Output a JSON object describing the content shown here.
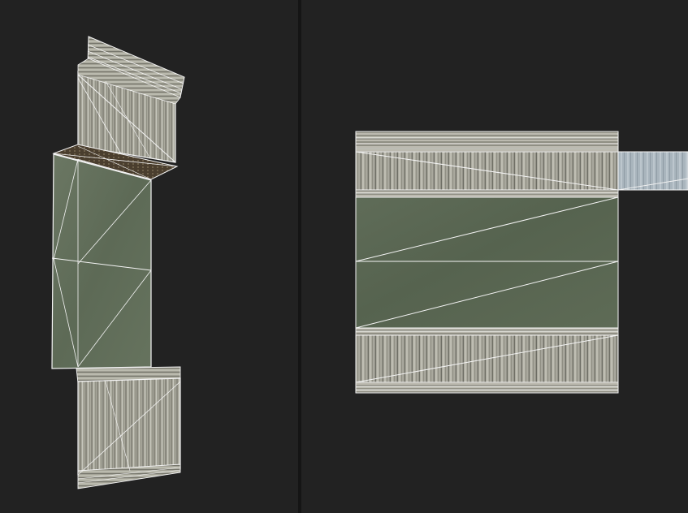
{
  "viewports": {
    "left": {
      "role": "3d-perspective",
      "mesh": "folded-panel-wireframe"
    },
    "right": {
      "role": "uv-editor",
      "layout": "unwrapped-panel-uv-islands"
    }
  },
  "colors": {
    "background": "#222222",
    "splitter": "#151515",
    "wireframe": "#f4f4f4",
    "wood_texture": "#a9a89c",
    "wood_grain_dark": "#4a4a44",
    "wood_grain_light": "#d6d6cc",
    "green_texture": "#5c6a55",
    "green_texture_light": "#6f7c66",
    "blue_strip": "#a8b4bd",
    "inner_fold": "#4b3f2f"
  }
}
